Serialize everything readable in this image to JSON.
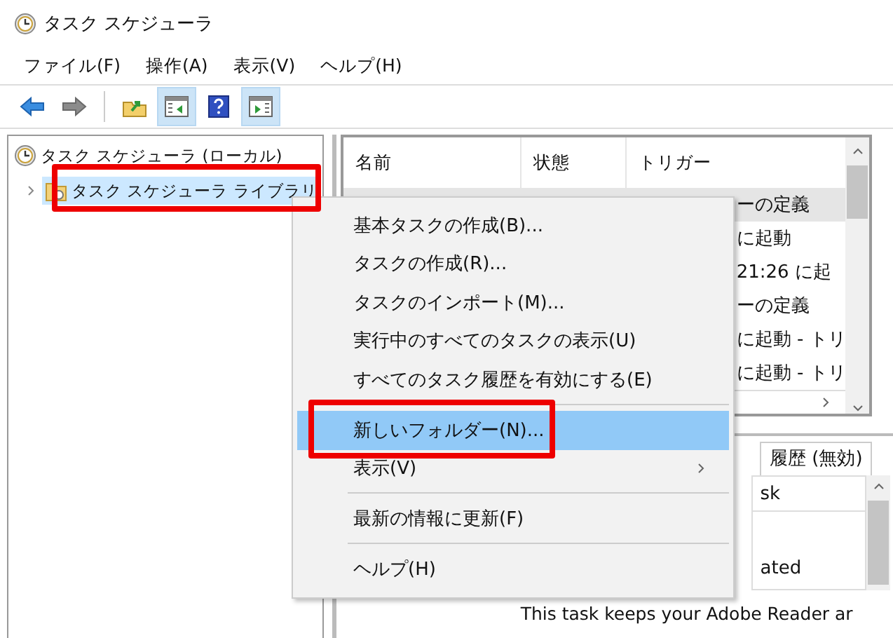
{
  "window": {
    "title": "タスク スケジューラ"
  },
  "menu_bar": [
    "ファイル(F)",
    "操作(A)",
    "表示(V)",
    "ヘルプ(H)"
  ],
  "toolbar": [
    {
      "kind": "back",
      "pressed": false
    },
    {
      "kind": "forward",
      "pressed": false
    },
    {
      "kind": "up",
      "pressed": false
    },
    {
      "kind": "console_tree",
      "pressed": true
    },
    {
      "kind": "help",
      "pressed": false
    },
    {
      "kind": "action_pane",
      "pressed": true
    }
  ],
  "tree": [
    {
      "label": "タスク スケジューラ (ローカル)",
      "selected": false,
      "children": [
        {
          "label": "タスク スケジューラ ライブラリ",
          "selected": true,
          "expanded": false
        }
      ]
    }
  ],
  "task_list": {
    "columns": [
      "名前",
      "状態",
      "トリガー"
    ],
    "rows": [
      {
        "trigger": "ーの定義",
        "selected": true
      },
      {
        "trigger": "に起動",
        "selected": false
      },
      {
        "trigger": "21:26 に起",
        "selected": false
      },
      {
        "trigger": "ーの定義",
        "selected": false
      },
      {
        "trigger": "に起動 - トリ",
        "selected": false
      },
      {
        "trigger": "に起動 - トリ",
        "selected": false
      }
    ]
  },
  "details": {
    "tab": "履歴 (無効)",
    "fields": [
      "sk",
      "ated"
    ],
    "description": "This task keeps your Adobe Reader ar"
  },
  "context_menu": [
    {
      "label": "基本タスクの作成(B)...",
      "selected": false,
      "submenu": false,
      "separator_before": false
    },
    {
      "label": "タスクの作成(R)...",
      "selected": false,
      "submenu": false,
      "separator_before": false
    },
    {
      "label": "タスクのインポート(M)...",
      "selected": false,
      "submenu": false,
      "separator_before": false
    },
    {
      "label": "実行中のすべてのタスクの表示(U)",
      "selected": false,
      "submenu": false,
      "separator_before": false
    },
    {
      "label": "すべてのタスク履歴を有効にする(E)",
      "selected": false,
      "submenu": false,
      "separator_before": false
    },
    {
      "label": "新しいフォルダー(N)...",
      "selected": true,
      "submenu": false,
      "separator_before": true
    },
    {
      "label": "表示(V)",
      "selected": false,
      "submenu": true,
      "separator_before": false
    },
    {
      "label": "最新の情報に更新(F)",
      "selected": false,
      "submenu": false,
      "separator_before": true
    },
    {
      "label": "ヘルプ(H)",
      "selected": false,
      "submenu": false,
      "separator_before": true
    }
  ]
}
